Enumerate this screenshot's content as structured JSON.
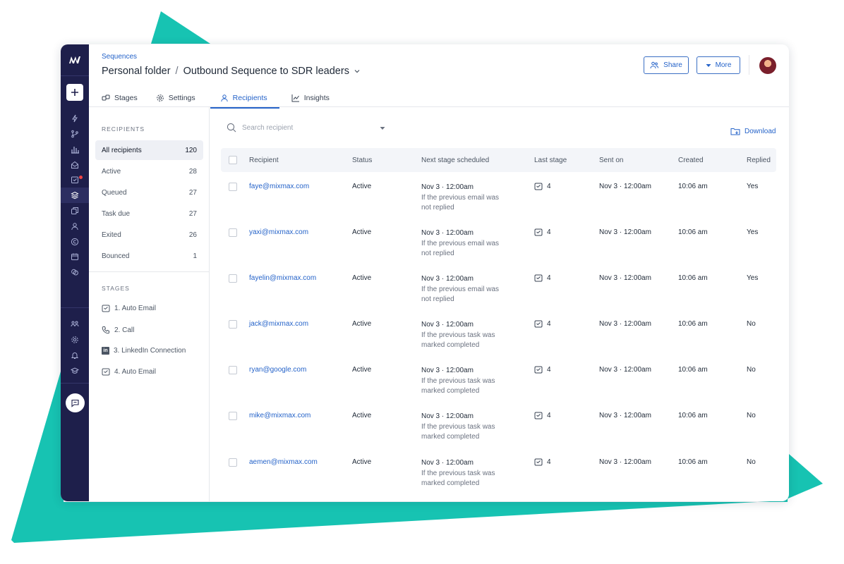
{
  "colors": {
    "accent": "#2563c9",
    "rail": "#1e1f4b",
    "decoration": "#17c3b2",
    "badge": "#ef4444"
  },
  "header": {
    "breadcrumb": "Sequences",
    "folder": "Personal folder",
    "separator": "/",
    "sequence_name": "Outbound Sequence to SDR leaders",
    "share_label": "Share",
    "more_label": "More"
  },
  "tabs": [
    {
      "label": "Stages",
      "icon": "stages-icon"
    },
    {
      "label": "Settings",
      "icon": "settings-icon"
    },
    {
      "label": "Recipients",
      "icon": "person-icon",
      "active": true
    },
    {
      "label": "Insights",
      "icon": "chart-icon"
    }
  ],
  "sidebar": {
    "recipients_title": "RECIPIENTS",
    "filters": [
      {
        "label": "All recipients",
        "count": "120",
        "active": true
      },
      {
        "label": "Active",
        "count": "28"
      },
      {
        "label": "Queued",
        "count": "27"
      },
      {
        "label": "Task due",
        "count": "27"
      },
      {
        "label": "Exited",
        "count": "26"
      },
      {
        "label": "Bounced",
        "count": "1"
      }
    ],
    "stages_title": "STAGES",
    "stages": [
      {
        "label": "1. Auto Email",
        "icon": "email-icon"
      },
      {
        "label": "2.  Call",
        "icon": "phone-icon"
      },
      {
        "label": "3. LinkedIn Connection",
        "icon": "linkedin-icon"
      },
      {
        "label": "4. Auto Email",
        "icon": "email-icon"
      }
    ]
  },
  "search": {
    "placeholder": "Search recipient"
  },
  "download_label": "Download",
  "table": {
    "columns": [
      "Recipient",
      "Status",
      "Next stage scheduled",
      "Last stage",
      "Sent on",
      "Created",
      "Replied"
    ],
    "rows": [
      {
        "email": "faye@mixmax.com",
        "status": "Active",
        "next_main": "Nov 3 · 12:00am",
        "next_line1": "If the previous email was",
        "next_line2": "not replied",
        "last_stage": "4",
        "sent_on": "Nov 3 · 12:00am",
        "created": "10:06 am",
        "replied": "Yes"
      },
      {
        "email": "yaxi@mixmax.com",
        "status": "Active",
        "next_main": "Nov 3 · 12:00am",
        "next_line1": "If the previous email was",
        "next_line2": "not replied",
        "last_stage": "4",
        "sent_on": "Nov 3 · 12:00am",
        "created": "10:06 am",
        "replied": "Yes"
      },
      {
        "email": "fayelin@mixmax.com",
        "status": "Active",
        "next_main": "Nov 3 · 12:00am",
        "next_line1": "If the previous email was",
        "next_line2": "not replied",
        "last_stage": "4",
        "sent_on": "Nov 3 · 12:00am",
        "created": "10:06 am",
        "replied": "Yes"
      },
      {
        "email": "jack@mixmax.com",
        "status": "Active",
        "next_main": "Nov 3 · 12:00am",
        "next_line1": "If the previous task was",
        "next_line2": "marked completed",
        "last_stage": "4",
        "sent_on": "Nov 3 · 12:00am",
        "created": "10:06 am",
        "replied": "No"
      },
      {
        "email": "ryan@google.com",
        "status": "Active",
        "next_main": "Nov 3 · 12:00am",
        "next_line1": "If the previous task was",
        "next_line2": "marked completed",
        "last_stage": "4",
        "sent_on": "Nov 3 · 12:00am",
        "created": "10:06 am",
        "replied": "No"
      },
      {
        "email": "mike@mixmax.com",
        "status": "Active",
        "next_main": "Nov 3 · 12:00am",
        "next_line1": "If the previous task was",
        "next_line2": "marked completed",
        "last_stage": "4",
        "sent_on": "Nov 3 · 12:00am",
        "created": "10:06 am",
        "replied": "No"
      },
      {
        "email": "aemen@mixmax.com",
        "status": "Active",
        "next_main": "Nov 3 · 12:00am",
        "next_line1": "If the previous task was",
        "next_line2": "marked completed",
        "last_stage": "4",
        "sent_on": "Nov 3 · 12:00am",
        "created": "10:06 am",
        "replied": "No"
      }
    ]
  }
}
